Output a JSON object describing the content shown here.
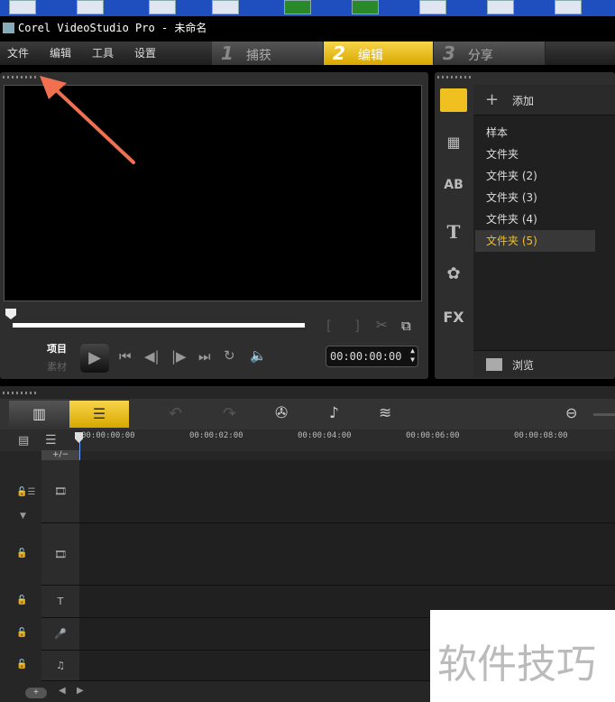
{
  "window": {
    "title": "Corel VideoStudio Pro - 未命名"
  },
  "menu": [
    "文件",
    "编辑",
    "工具",
    "设置"
  ],
  "steps": [
    {
      "num": "1",
      "label": "捕获"
    },
    {
      "num": "2",
      "label": "编辑",
      "active": true
    },
    {
      "num": "3",
      "label": "分享"
    }
  ],
  "player": {
    "mode_project": "项目",
    "mode_clip": "素材",
    "timecode": "00:00:00:00"
  },
  "library": {
    "add_label": "添加",
    "items": [
      "样本",
      "文件夹",
      "文件夹 (2)",
      "文件夹 (3)",
      "文件夹 (4)",
      "文件夹 (5)"
    ],
    "selected_index": 5,
    "browse_label": "浏览",
    "fx_label": "FX",
    "ab_label": "AB",
    "text_label": "T"
  },
  "timeline": {
    "ticks": [
      "00:00:00:00",
      "00:00:02:00",
      "00:00:04:00",
      "00:00:06:00",
      "00:00:08:00"
    ],
    "add_remove_label": "+/−"
  },
  "watermark": "软件技巧",
  "colors": {
    "accent": "#f0c020",
    "arrow": "#f07050"
  }
}
